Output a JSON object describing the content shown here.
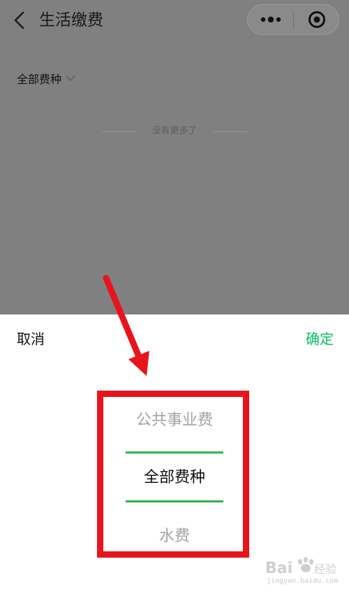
{
  "nav": {
    "title": "生活缴费",
    "back_icon": "chevron-left-icon",
    "more_icon": "more-dots-icon",
    "close_icon": "target-close-icon"
  },
  "filter": {
    "label": "全部费种",
    "icon": "chevron-down-icon"
  },
  "list": {
    "empty_text": "没有更多了"
  },
  "picker": {
    "cancel_label": "取消",
    "confirm_label": "确定",
    "options": [
      "公共事业费",
      "全部费种",
      "水费"
    ],
    "selected_index": 1
  },
  "watermark": {
    "brand": "Bai",
    "brand2": "经验",
    "url": "jingyan.baidu.com"
  },
  "colors": {
    "overlay": "#808080",
    "accent": "#07c160",
    "selection_line": "#2db54a",
    "annotation_red": "#e8141c"
  }
}
